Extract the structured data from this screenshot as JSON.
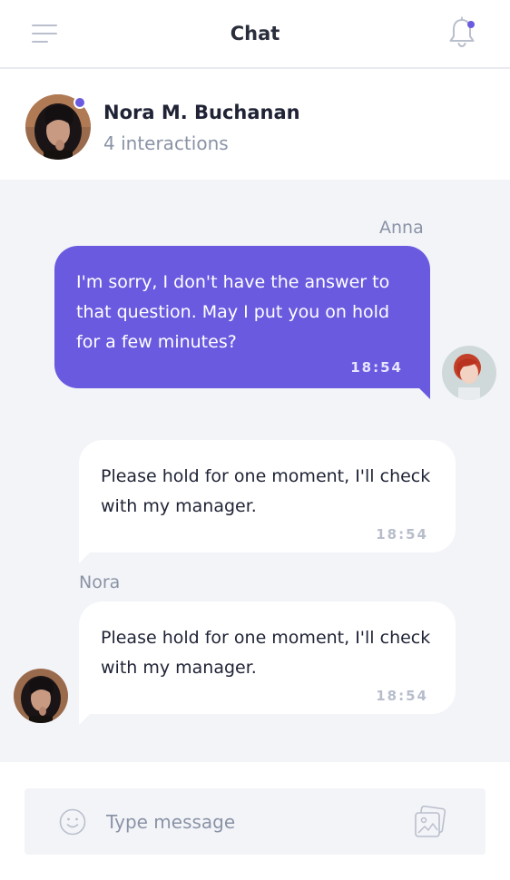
{
  "header": {
    "title": "Chat",
    "menu_icon": "hamburger-menu-icon",
    "bell_icon": "bell-icon",
    "notification_dot": true
  },
  "contact": {
    "name": "Nora M. Buchanan",
    "subtitle": "4 interactions",
    "online": true
  },
  "messages": [
    {
      "sender": "Anna",
      "direction": "outgoing",
      "text": "I'm sorry, I don't have the answer to that question. May I put you on hold for a few minutes?",
      "time": "18:54"
    },
    {
      "sender": "",
      "direction": "incoming",
      "text": "Please hold for one moment, I'll check with my manager.",
      "time": "18:54"
    },
    {
      "sender": "Nora",
      "direction": "incoming",
      "text": "Please hold for one moment, I'll check with my manager.",
      "time": "18:54"
    }
  ],
  "composer": {
    "placeholder": "Type message",
    "value": "",
    "emoji_icon": "smiley-icon",
    "attach_icon": "image-gallery-icon"
  },
  "colors": {
    "accent": "#6a5ae0",
    "chat_background": "#f3f4f8",
    "muted_text": "#8a93a6"
  }
}
